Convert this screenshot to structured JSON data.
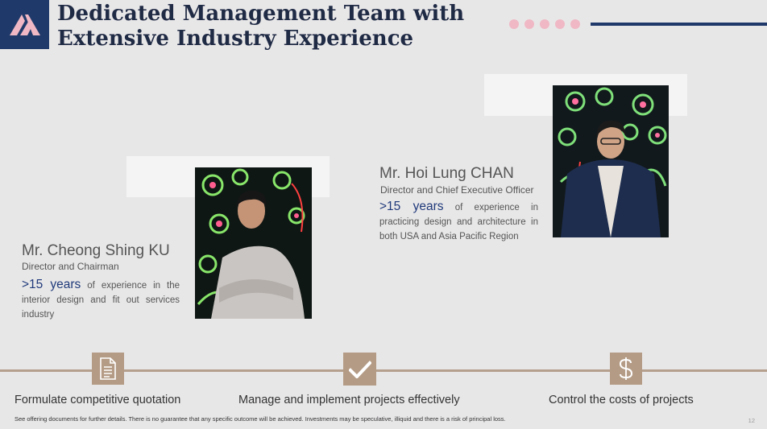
{
  "header": {
    "title": "Dedicated Management Team with\nExtensive Industry Experience"
  },
  "colors": {
    "brand_navy": "#1f3a6a",
    "accent_pink": "#efb8c4",
    "accent_tan": "#b49b85"
  },
  "people": [
    {
      "name": "Mr. Hoi Lung CHAN",
      "role": "Director and Chief Executive Officer",
      "years": ">15 years",
      "description": " of experience in practicing design and architecture in both USA and Asia Pacific Region"
    },
    {
      "name": "Mr. Cheong Shing KU",
      "role": "Director and Chairman",
      "years": ">15 years",
      "description": " of experience in the interior design and fit out services industry"
    }
  ],
  "features": [
    {
      "label": "Formulate competitive quotation",
      "icon": "document-icon"
    },
    {
      "label": "Manage and implement projects effectively",
      "icon": "checkmark-icon"
    },
    {
      "label": "Control the costs of projects",
      "icon": "dollar-icon"
    }
  ],
  "footer": {
    "disclaimer": "See offering documents for further details. There is no guarantee that any specific outcome will be achieved. Investments may be speculative, illiquid and there is a risk of principal loss.",
    "page_number": "12"
  }
}
